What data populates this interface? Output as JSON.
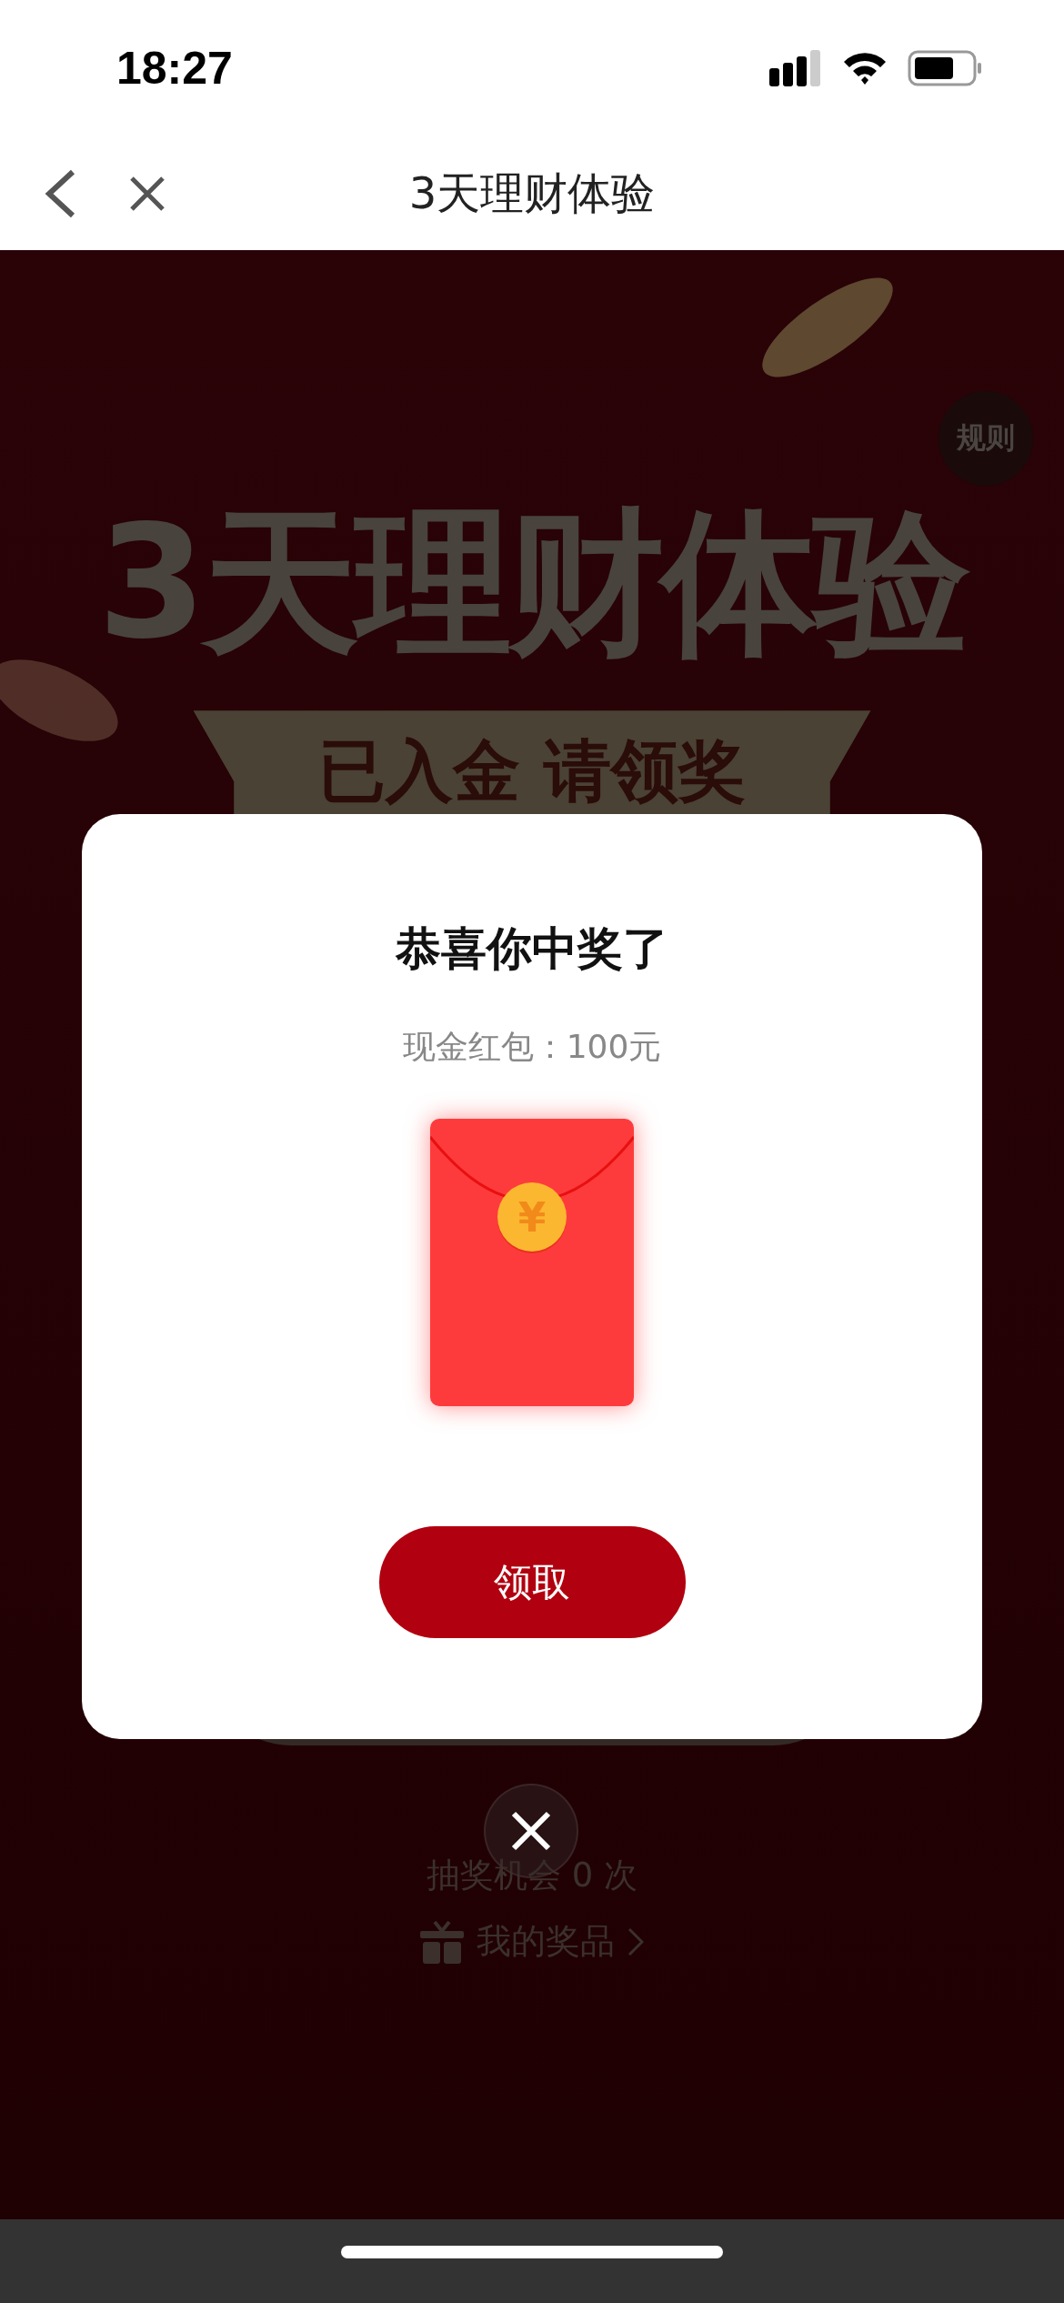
{
  "status_bar": {
    "time": "18:27"
  },
  "nav": {
    "title": "3天理财体验"
  },
  "page": {
    "rules_button": "规则",
    "headline": "3天理财体验",
    "banner": "已入金 请领奖",
    "chances": "抽奖机会 0 次",
    "my_prizes": "我的奖品"
  },
  "modal": {
    "title": "恭喜你中奖了",
    "prize": "现金红包：100元",
    "envelope_symbol": "¥",
    "claim_button": "领取"
  }
}
